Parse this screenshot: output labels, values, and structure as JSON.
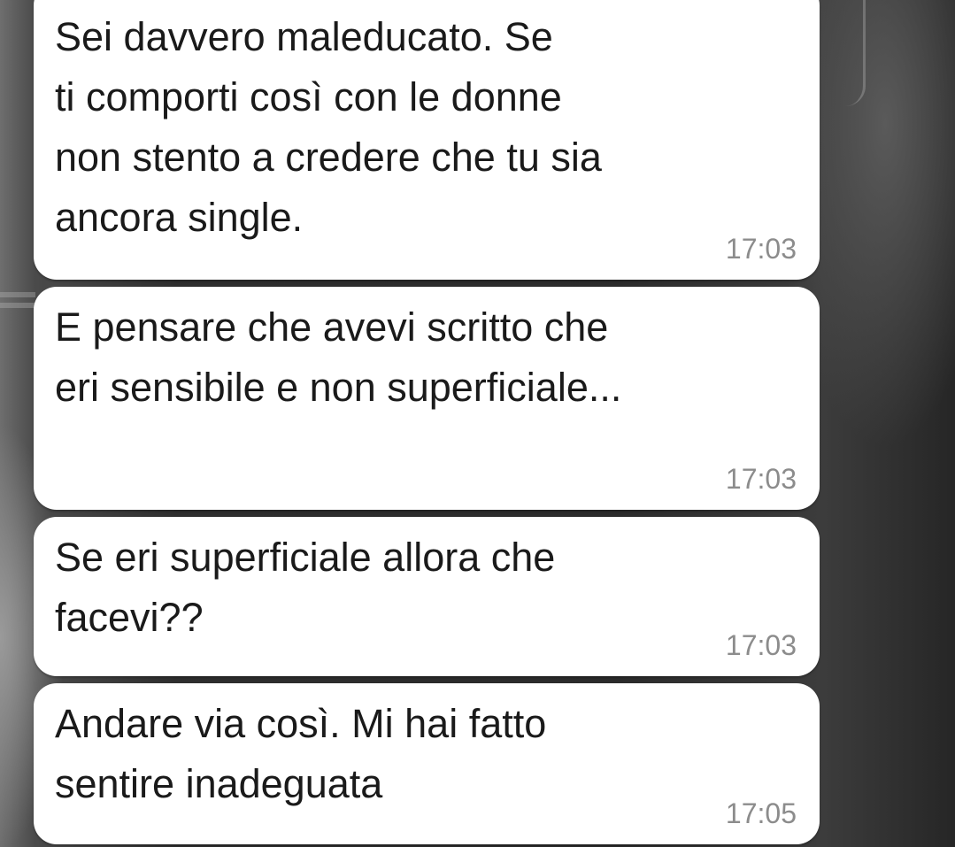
{
  "messages": [
    {
      "text": "Sei davvero maleducato. Se\nti comporti così con le donne\nnon stento a credere che tu sia\nancora single.",
      "time": "17:03"
    },
    {
      "text": "E pensare che avevi scritto che\neri sensibile e non superficiale...",
      "time": "17:03"
    },
    {
      "text": "Se eri superficiale allora che\nfacevi??",
      "time": "17:03"
    },
    {
      "text": "Andare via così. Mi hai fatto\nsentire inadeguata",
      "time": "17:05"
    }
  ],
  "colors": {
    "bubble": "#ffffff",
    "text": "#1a1a1a",
    "timestamp": "#8c8c8c",
    "wallpaper": "#2b2b2b"
  }
}
